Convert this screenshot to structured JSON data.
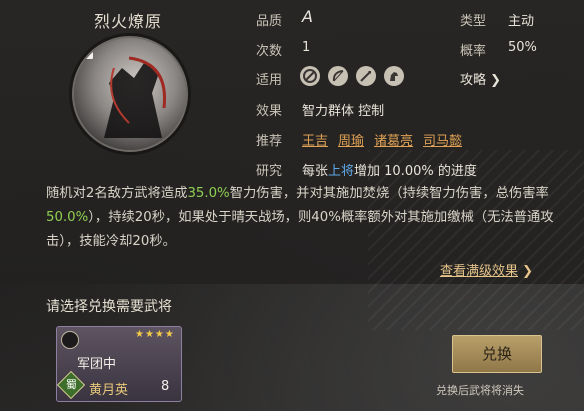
{
  "skill": {
    "name": "烈火燎原",
    "quality_label": "品质",
    "quality_value": "A",
    "count_label": "次数",
    "count_value": "1",
    "type_label": "类型",
    "type_value": "主动",
    "rate_label": "概率",
    "rate_value": "50%",
    "applicable_label": "适用",
    "strategy_label": "攻略",
    "strategy_arrow": "❯",
    "effect_label": "效果",
    "effect_value": "智力群体 控制",
    "recommend_label": "推荐",
    "recommend": [
      "王吉",
      "周瑜",
      "诸葛亮",
      "司马懿"
    ],
    "research_label": "研究",
    "research_pre": "每张",
    "research_mid": "上将",
    "research_post": "增加 10.00% 的进度"
  },
  "description": {
    "p1": "随机对2名敌方武将造成",
    "p2": "35.0%",
    "p3": "智力伤害，并对其施加焚烧（持续智力伤害，总伤害率",
    "p4": "50.0%",
    "p5": "），持续20秒，如果处于晴天战场，则40%概率额外对其施加缴械（无法普通攻击），技能冷却20秒。"
  },
  "full_effect_link": "查看满级效果",
  "full_effect_arrow": "❯",
  "select_title": "请选择兑换需要武将",
  "card": {
    "label": "军团中",
    "faction": "蜀",
    "name": "黄月英",
    "level": "8",
    "stars": "★★★★"
  },
  "exchange_button": "兑换",
  "note": "兑换后武将将消失"
}
